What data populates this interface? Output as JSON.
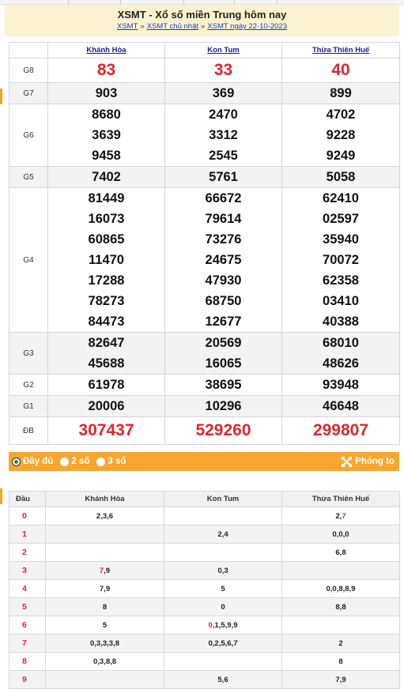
{
  "header": {
    "title": "XSMT - Xổ số miền Trung hôm nay",
    "crumb1": "XSMT",
    "crumb2": "XSMT chủ nhật",
    "crumb3": "XSMT ngày 22-10-2023",
    "separator": "»"
  },
  "provinces": [
    "Khánh Hòa",
    "Kon Tum",
    "Thừa Thiên Huế"
  ],
  "prizes": [
    {
      "label": "G8",
      "values": [
        [
          "83"
        ],
        [
          "33"
        ],
        [
          "40"
        ]
      ],
      "red": true
    },
    {
      "label": "G7",
      "values": [
        [
          "903"
        ],
        [
          "369"
        ],
        [
          "899"
        ]
      ]
    },
    {
      "label": "G6",
      "values": [
        [
          "8680",
          "3639",
          "9458"
        ],
        [
          "2470",
          "3312",
          "2545"
        ],
        [
          "4702",
          "9228",
          "9249"
        ]
      ]
    },
    {
      "label": "G5",
      "values": [
        [
          "7402"
        ],
        [
          "5761"
        ],
        [
          "5058"
        ]
      ]
    },
    {
      "label": "G4",
      "values": [
        [
          "81449",
          "16073",
          "60865",
          "11470",
          "17288",
          "78273",
          "84473"
        ],
        [
          "66672",
          "79614",
          "73276",
          "24675",
          "47930",
          "68750",
          "12677"
        ],
        [
          "62410",
          "02597",
          "35940",
          "70072",
          "62358",
          "03410",
          "40388"
        ]
      ]
    },
    {
      "label": "G3",
      "values": [
        [
          "82647",
          "45688"
        ],
        [
          "20569",
          "16065"
        ],
        [
          "68010",
          "48626"
        ]
      ]
    },
    {
      "label": "G2",
      "values": [
        [
          "61978"
        ],
        [
          "38695"
        ],
        [
          "93948"
        ]
      ]
    },
    {
      "label": "G1",
      "values": [
        [
          "20006"
        ],
        [
          "10296"
        ],
        [
          "46648"
        ]
      ]
    },
    {
      "label": "ĐB",
      "values": [
        [
          "307437"
        ],
        [
          "529260"
        ],
        [
          "299807"
        ]
      ],
      "red": true
    }
  ],
  "options": {
    "full": "Đầy đủ",
    "two": "2 số",
    "three": "3 số",
    "zoom": "Phóng to"
  },
  "dau_table": {
    "head_col": "Đầu",
    "rows": [
      {
        "d": "0",
        "c": [
          [
            [
              "2,3,6",
              false
            ]
          ],
          [],
          [
            [
              "2,",
              false
            ],
            [
              "7",
              true
            ]
          ]
        ]
      },
      {
        "d": "1",
        "c": [
          [],
          [
            [
              "2,4",
              false
            ]
          ],
          [
            [
              "0,0,0",
              false
            ]
          ]
        ]
      },
      {
        "d": "2",
        "c": [
          [],
          [],
          [
            [
              "6,8",
              false
            ]
          ]
        ]
      },
      {
        "d": "3",
        "c": [
          [
            [
              "7",
              true
            ],
            [
              ",9",
              false
            ]
          ],
          [
            [
              "0,3",
              false
            ]
          ],
          []
        ]
      },
      {
        "d": "4",
        "c": [
          [
            [
              "7,9",
              false
            ]
          ],
          [
            [
              "5",
              false
            ]
          ],
          [
            [
              "0,0,8,8,9",
              false
            ]
          ]
        ]
      },
      {
        "d": "5",
        "c": [
          [
            [
              "8",
              false
            ]
          ],
          [
            [
              "0",
              false
            ]
          ],
          [
            [
              "8,8",
              false
            ]
          ]
        ]
      },
      {
        "d": "6",
        "c": [
          [
            [
              "5",
              false
            ]
          ],
          [
            [
              "0",
              true
            ],
            [
              ",1,5,9,9",
              false
            ]
          ],
          []
        ]
      },
      {
        "d": "7",
        "c": [
          [
            [
              "0,3,3,3,8",
              false
            ]
          ],
          [
            [
              "0,2,5,6,7",
              false
            ]
          ],
          [
            [
              "2",
              false
            ]
          ]
        ]
      },
      {
        "d": "8",
        "c": [
          [
            [
              "0,3,8,8",
              false
            ]
          ],
          [],
          [
            [
              "8",
              false
            ]
          ]
        ]
      },
      {
        "d": "9",
        "c": [
          [],
          [
            [
              "5,6",
              false
            ]
          ],
          [
            [
              "7,9",
              false
            ]
          ]
        ]
      }
    ]
  },
  "colors": {
    "accent": "#f7a630",
    "red": "#e0262d",
    "link": "#1a3fc0",
    "header_bg": "#fbf3cf"
  }
}
